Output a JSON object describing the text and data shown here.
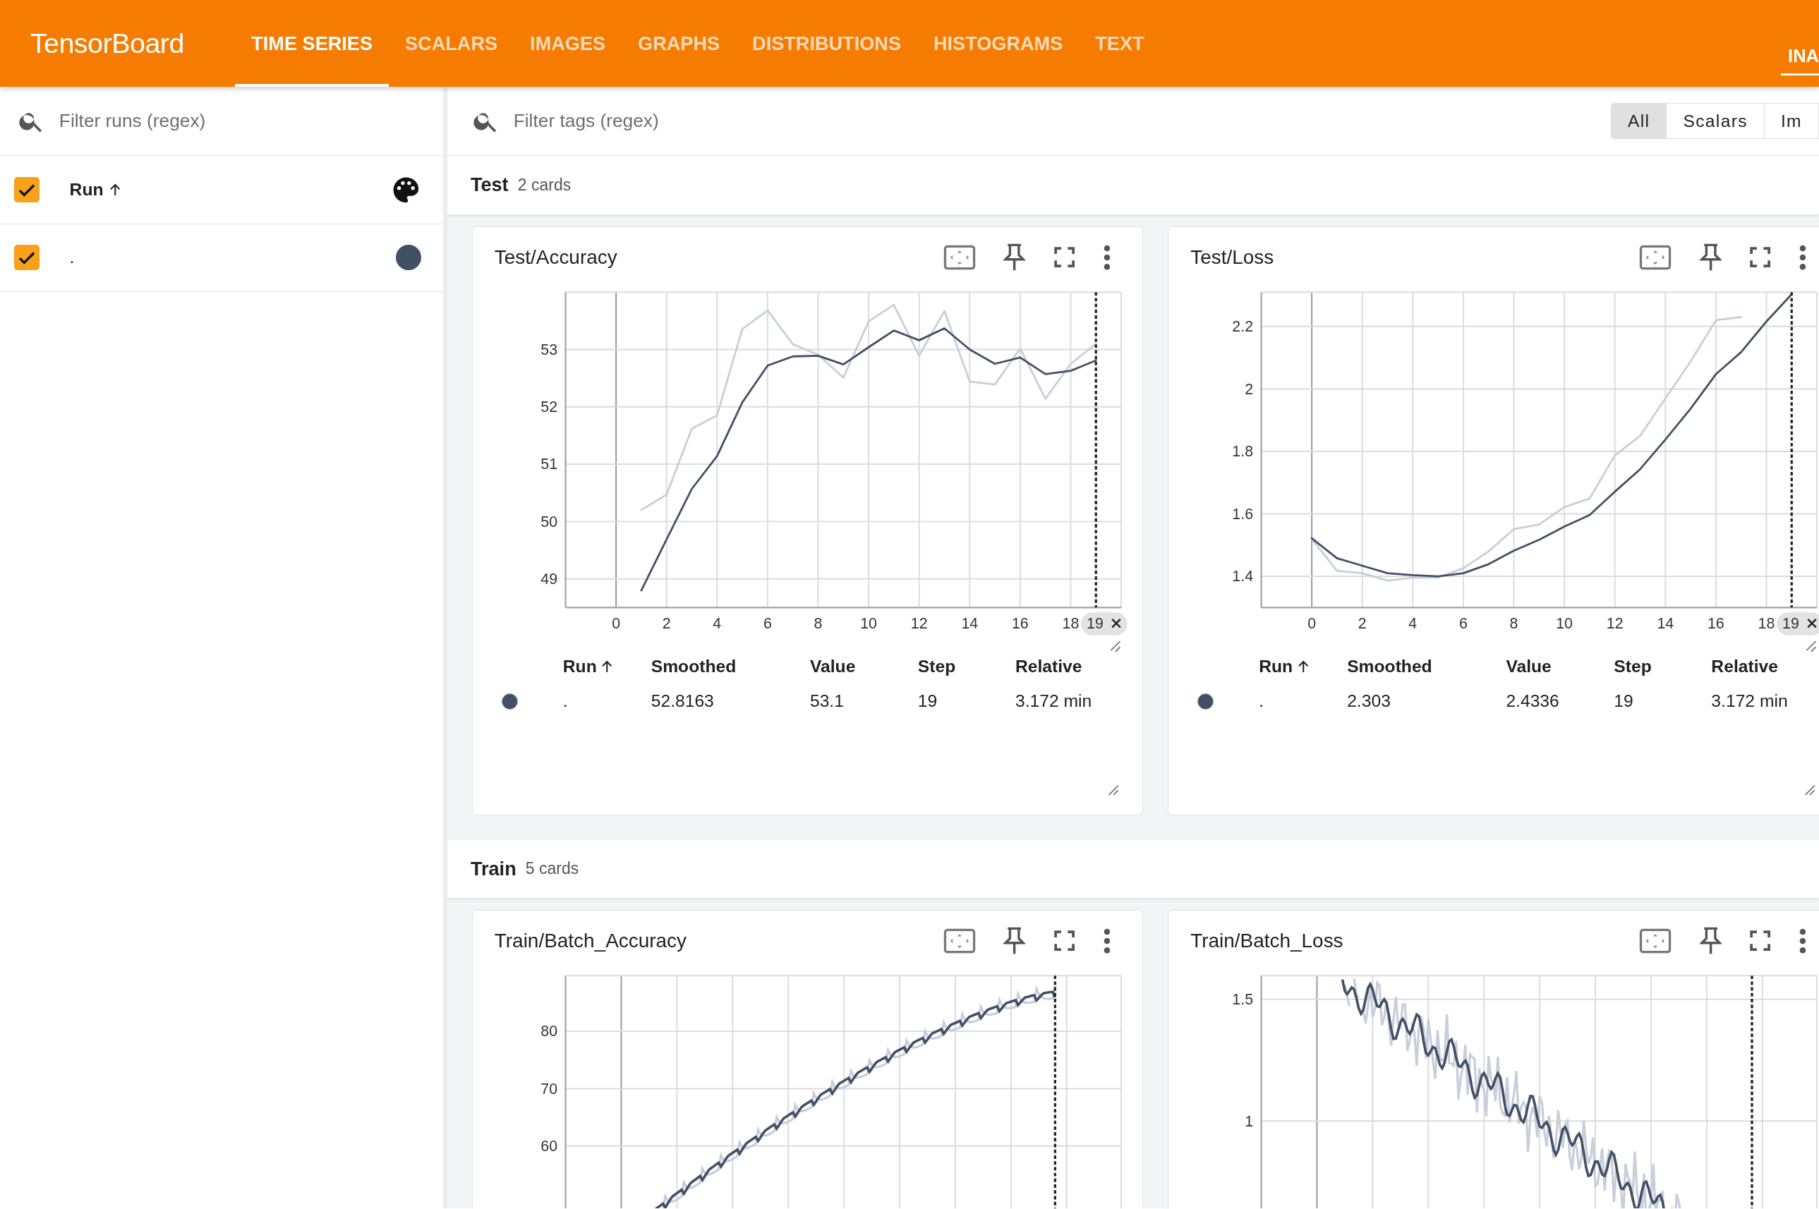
{
  "app": {
    "title": "TensorBoard"
  },
  "tabs": [
    {
      "label": "TIME SERIES",
      "selected": true
    },
    {
      "label": "SCALARS",
      "selected": false
    },
    {
      "label": "IMAGES",
      "selected": false
    },
    {
      "label": "GRAPHS",
      "selected": false
    },
    {
      "label": "DISTRIBUTIONS",
      "selected": false
    },
    {
      "label": "HISTOGRAMS",
      "selected": false
    },
    {
      "label": "TEXT",
      "selected": false
    }
  ],
  "header_dropdown": {
    "label": "INA"
  },
  "sidebar": {
    "search": {
      "placeholder": "Filter runs (regex)"
    },
    "header": {
      "label": "Run",
      "checked": true
    },
    "runs": [
      {
        "name": ".",
        "checked": true,
        "color": "#425066"
      }
    ]
  },
  "main": {
    "search": {
      "placeholder": "Filter tags (regex)"
    },
    "filters": [
      {
        "label": "All",
        "selected": true
      },
      {
        "label": "Scalars",
        "selected": false
      },
      {
        "label": "Im",
        "selected": false
      }
    ],
    "groups": [
      {
        "name": "Test",
        "count": "2 cards",
        "cards": [
          {
            "title": "Test/Accuracy",
            "kind": "line-chart",
            "chart_data": {
              "type": "line",
              "grid": true,
              "ref_lines": [
                {
                  "axis": "x",
                  "value": 19,
                  "label": "19"
                }
              ],
              "x": [
                1,
                2,
                3,
                4,
                5,
                6,
                7,
                8,
                9,
                10,
                11,
                12,
                13,
                14,
                15,
                16,
                17,
                18,
                19
              ],
              "xlim": [
                -2,
                20
              ],
              "ylim": [
                48.5,
                54
              ],
              "xticks": [
                0,
                2,
                4,
                6,
                8,
                10,
                12,
                14,
                16,
                18
              ],
              "yticks": [
                49,
                50,
                51,
                52,
                53
              ],
              "series": [
                {
                  "color": "#c8cedb",
                  "values": [
                    50.2,
                    50.47,
                    51.62,
                    51.85,
                    53.36,
                    53.68,
                    53.09,
                    52.91,
                    52.51,
                    53.49,
                    53.78,
                    52.89,
                    53.67,
                    52.44,
                    52.39,
                    53.02,
                    52.14,
                    52.75,
                    53.1
                  ]
                },
                {
                  "color": "#425066",
                  "values": [
                    48.8,
                    49.69,
                    50.57,
                    51.14,
                    52.08,
                    52.72,
                    52.88,
                    52.89,
                    52.74,
                    53.04,
                    53.33,
                    53.16,
                    53.37,
                    53.0,
                    52.75,
                    52.86,
                    52.57,
                    52.63,
                    52.81
                  ]
                }
              ]
            },
            "table": {
              "columns": [
                {
                  "label": "Run",
                  "sorted": true
                },
                {
                  "label": "Smoothed",
                  "sorted": false
                },
                {
                  "label": "Value",
                  "sorted": false
                },
                {
                  "label": "Step",
                  "sorted": false
                },
                {
                  "label": "Relative",
                  "sorted": false
                }
              ],
              "rows": [
                {
                  "color": "#425066",
                  "cells": [
                    ".",
                    "52.8163",
                    "53.1",
                    "19",
                    "3.172 min"
                  ]
                }
              ]
            }
          },
          {
            "title": "Test/Loss",
            "kind": "line-chart",
            "chart_data": {
              "type": "line",
              "grid": true,
              "ref_lines": [
                {
                  "axis": "x",
                  "value": 19,
                  "label": "19"
                }
              ],
              "x": [
                0,
                1,
                2,
                3,
                4,
                5,
                6,
                7,
                8,
                9,
                10,
                11,
                12,
                13,
                14,
                15,
                16,
                17,
                18,
                19
              ],
              "xlim": [
                -2,
                20
              ],
              "ylim": [
                1.3,
                2.31
              ],
              "xticks": [
                0,
                2,
                4,
                6,
                8,
                10,
                12,
                14,
                16,
                18
              ],
              "yticks": [
                {
                  "value": 1.4,
                  "label": "1.4"
                },
                {
                  "value": 1.6,
                  "label": "1.6"
                },
                {
                  "value": 1.8,
                  "label": "1.8"
                },
                {
                  "value": 2,
                  "label": "2"
                },
                {
                  "value": 2.2,
                  "label": "2.2"
                }
              ],
              "series": [
                {
                  "color": "#c8cedb",
                  "values": [
                    1.52,
                    1.418,
                    1.41,
                    1.386,
                    1.396,
                    1.396,
                    1.426,
                    1.48,
                    1.551,
                    1.566,
                    1.622,
                    1.649,
                    1.787,
                    1.85,
                    1.97,
                    2.088,
                    2.22,
                    2.23,
                    null,
                    null
                  ]
                },
                {
                  "color": "#425066",
                  "values": [
                    1.522,
                    1.458,
                    1.434,
                    1.41,
                    1.404,
                    1.4,
                    1.41,
                    1.439,
                    1.482,
                    1.517,
                    1.559,
                    1.596,
                    1.671,
                    1.743,
                    1.838,
                    1.937,
                    2.047,
                    2.118,
                    2.216,
                    2.303
                  ]
                }
              ]
            },
            "table": {
              "columns": [
                {
                  "label": "Run",
                  "sorted": true
                },
                {
                  "label": "Smoothed",
                  "sorted": false
                },
                {
                  "label": "Value",
                  "sorted": false
                },
                {
                  "label": "Step",
                  "sorted": false
                },
                {
                  "label": "Relative",
                  "sorted": false
                }
              ],
              "rows": [
                {
                  "color": "#425066",
                  "cells": [
                    ".",
                    "2.303",
                    "2.4336",
                    "19",
                    "3.172 min"
                  ]
                }
              ]
            }
          }
        ]
      },
      {
        "name": "Train",
        "count": "5 cards",
        "cards": [
          {
            "title": "Train/Batch_Accuracy",
            "kind": "rising-picture",
            "y_tick_labels": [
              "80",
              "70",
              "60"
            ]
          },
          {
            "title": "Train/Batch_Loss",
            "kind": "falling-picture",
            "y_tick_labels": [
              "1.5",
              "1"
            ]
          }
        ]
      }
    ]
  }
}
